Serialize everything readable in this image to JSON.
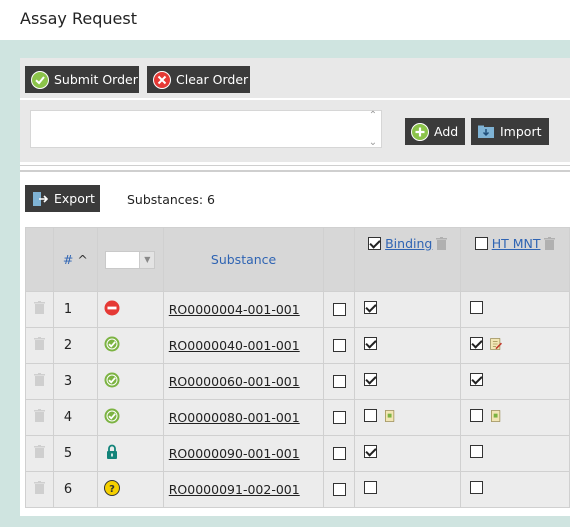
{
  "window": {
    "title": "Assay Request"
  },
  "toolbar": {
    "submit_label": "Submit Order",
    "clear_label": "Clear Order"
  },
  "entry": {
    "textarea_value": "",
    "add_label": "Add",
    "import_label": "Import"
  },
  "list_toolbar": {
    "export_label": "Export",
    "substances_count": "Substances: 6"
  },
  "table": {
    "headers": {
      "number": "#",
      "sort_indicator": "^",
      "substance": "Substance",
      "assay1": "Binding",
      "assay2": "HT MNT"
    },
    "assay1_header_checked": true,
    "assay2_header_checked": false,
    "rows": [
      {
        "num": "1",
        "status": "blocked",
        "substance": "RO0000004-001-001",
        "select": false,
        "assay1": true,
        "assay1_note": false,
        "assay2": false,
        "assay2_note": false
      },
      {
        "num": "2",
        "status": "ok",
        "substance": "RO0000040-001-001",
        "select": false,
        "assay1": true,
        "assay1_note": false,
        "assay2": true,
        "assay2_note": true
      },
      {
        "num": "3",
        "status": "ok",
        "substance": "RO0000060-001-001",
        "select": false,
        "assay1": true,
        "assay1_note": false,
        "assay2": true,
        "assay2_note": false
      },
      {
        "num": "4",
        "status": "ok",
        "substance": "RO0000080-001-001",
        "select": false,
        "assay1": false,
        "assay1_note": true,
        "assay2": false,
        "assay2_note": true
      },
      {
        "num": "5",
        "status": "locked",
        "substance": "RO0000090-001-001",
        "select": false,
        "assay1": true,
        "assay1_note": false,
        "assay2": false,
        "assay2_note": false
      },
      {
        "num": "6",
        "status": "unknown",
        "substance": "RO0000091-002-001",
        "select": false,
        "assay1": false,
        "assay1_note": false,
        "assay2": false,
        "assay2_note": false
      }
    ]
  },
  "colors": {
    "accent_green": "#7cb342",
    "danger_red": "#e53935",
    "button_dark": "#3b3b3b",
    "link_blue": "#2f64b3",
    "canvas_teal": "#cfe4e0"
  }
}
